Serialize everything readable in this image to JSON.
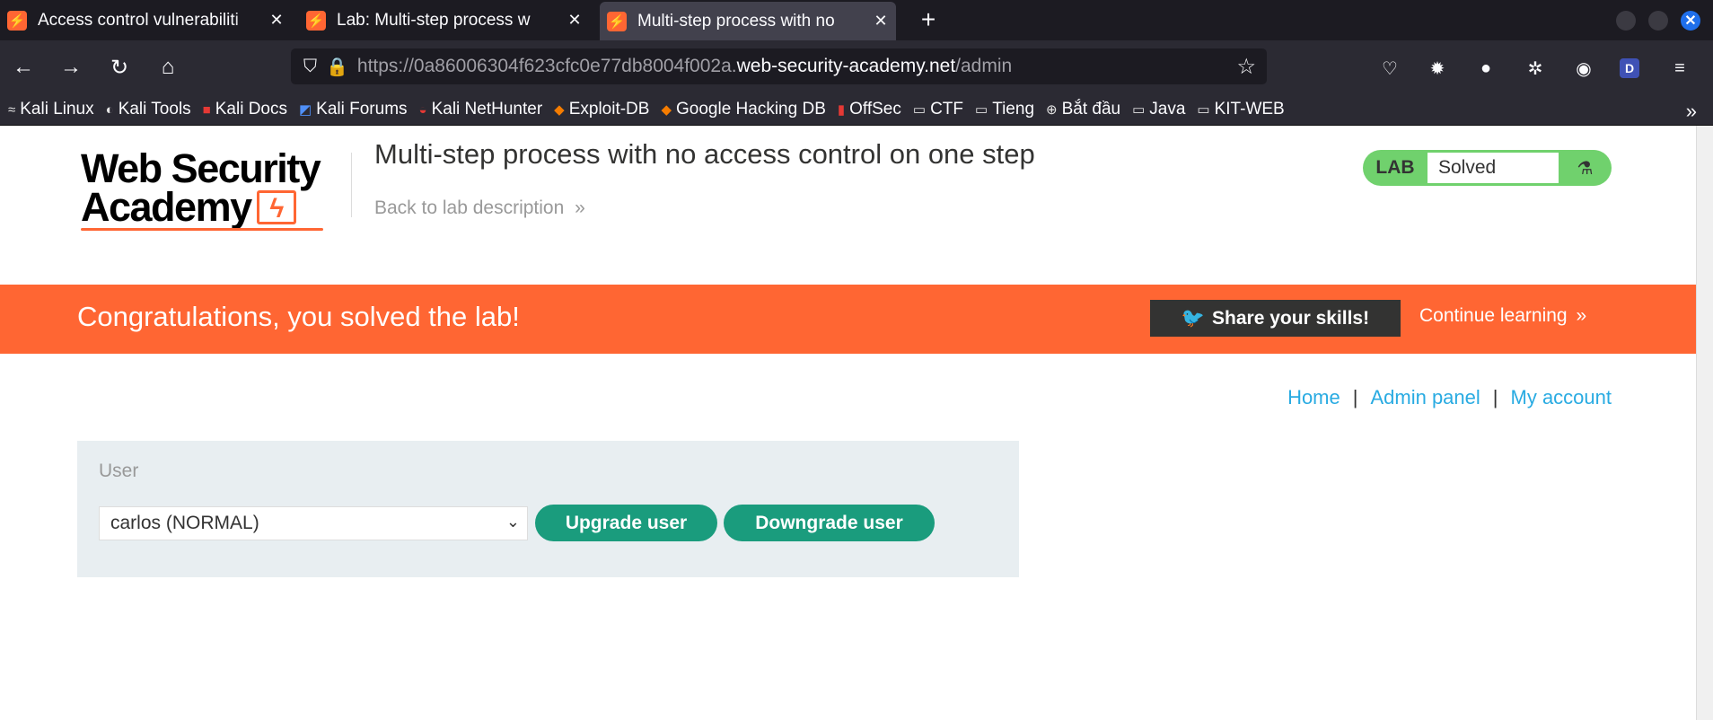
{
  "browser": {
    "tabs": [
      {
        "label": "Access control vulnerabiliti",
        "active": false
      },
      {
        "label": "Lab: Multi-step process w",
        "active": false
      },
      {
        "label": "Multi-step process with no",
        "active": true
      }
    ],
    "new_tab": "+",
    "url_prefix": "https://0a86006304f623cfc0e77db8004f002a.",
    "url_domain": "web-security-academy.net",
    "url_path": "/admin",
    "bookmarks": [
      "Kali Linux",
      "Kali Tools",
      "Kali Docs",
      "Kali Forums",
      "Kali NetHunter",
      "Exploit-DB",
      "Google Hacking DB",
      "OffSec",
      "CTF",
      "Tieng",
      "Bắt đầu",
      "Java",
      "KIT-WEB"
    ],
    "ext_badge": "D"
  },
  "header": {
    "logo_line1": "Web Security",
    "logo_line2": "Academy",
    "lab_title": "Multi-step process with no access control on one step",
    "back_link": "Back to lab description",
    "status_label": "LAB",
    "status_value": "Solved"
  },
  "banner": {
    "message": "Congratulations, you solved the lab!",
    "share": "Share your skills!",
    "continue": "Continue learning"
  },
  "nav": {
    "home": "Home",
    "admin": "Admin panel",
    "account": "My account",
    "sep": "|"
  },
  "admin": {
    "user_label": "User",
    "selected_user": "carlos (NORMAL)",
    "upgrade": "Upgrade user",
    "downgrade": "Downgrade user"
  },
  "colors": {
    "accent": "#ff6633",
    "button_green": "#1a9c7d",
    "link": "#29abe2",
    "status_green": "#70d16d"
  }
}
